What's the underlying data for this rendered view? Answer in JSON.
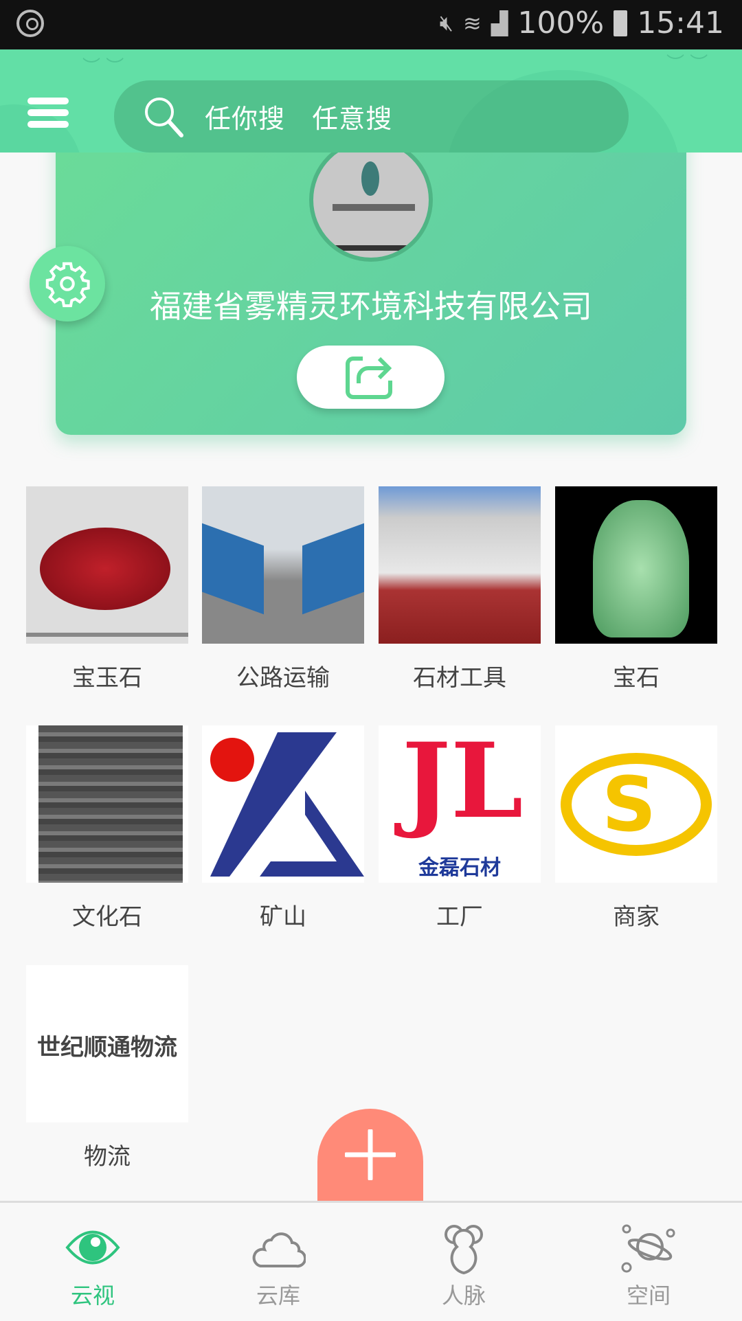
{
  "status_bar": {
    "battery": "100%",
    "time": "15:41",
    "icons": [
      "sync-icon",
      "mute-icon",
      "wifi-icon",
      "signal-icon",
      "battery-icon"
    ]
  },
  "header": {
    "search_placeholder": "任你搜   任意搜",
    "menu_icon": "hamburger-icon",
    "search_icon": "search-icon"
  },
  "profile": {
    "company_name": "福建省雾精灵环境科技有限公司",
    "settings_icon": "gear-icon",
    "share_icon": "share-icon"
  },
  "categories": [
    {
      "label": "宝玉石"
    },
    {
      "label": "公路运输"
    },
    {
      "label": "石材工具"
    },
    {
      "label": "宝石"
    },
    {
      "label": "文化石"
    },
    {
      "label": "矿山"
    },
    {
      "label": "工厂",
      "logo_text": "金磊石材"
    },
    {
      "label": "商家"
    },
    {
      "label": "物流",
      "image_text": "世纪顺通物流"
    }
  ],
  "fab": {
    "icon": "plus-icon",
    "color": "#ff8a78"
  },
  "bottom_nav": {
    "active": 0,
    "accent": "#2ec47e",
    "items": [
      {
        "label": "云视",
        "icon": "eye-icon"
      },
      {
        "label": "云库",
        "icon": "cloud-icon"
      },
      {
        "label": "人脉",
        "icon": "people-icon"
      },
      {
        "label": "空间",
        "icon": "planet-icon"
      }
    ]
  }
}
